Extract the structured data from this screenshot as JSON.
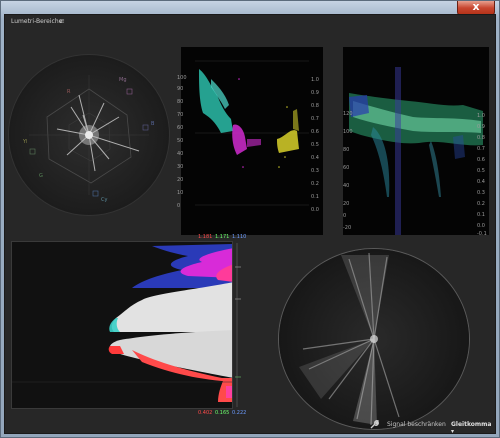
{
  "window": {
    "close_glyph": "x"
  },
  "panel": {
    "title": "Lumetri-Bereiche",
    "menu_glyph": "≡"
  },
  "waveform1": {
    "left_ticks": [
      "100",
      "90",
      "80",
      "70",
      "60",
      "50",
      "40",
      "30",
      "20",
      "10",
      "0"
    ],
    "right_ticks": [
      "1.0",
      "0.9",
      "0.8",
      "0.7",
      "0.6",
      "0.5",
      "0.4",
      "0.3",
      "0.2",
      "0.1",
      "0.0"
    ]
  },
  "waveform2": {
    "left_ticks": [
      "120",
      "100",
      "80",
      "60",
      "40",
      "20",
      "0",
      "-20"
    ],
    "right_ticks": [
      "1.0",
      "0.9",
      "0.8",
      "0.7",
      "0.6",
      "0.5",
      "0.4",
      "0.3",
      "0.2",
      "0.1",
      "0.0",
      "-0.1"
    ]
  },
  "histogram": {
    "top_values": [
      {
        "text": "1.181",
        "color": "#ff4a4a"
      },
      {
        "text": "1.171",
        "color": "#6cff6c"
      },
      {
        "text": "1.110",
        "color": "#6c9cff"
      }
    ],
    "bottom_values": [
      {
        "text": "0.402",
        "color": "#ff4a4a"
      },
      {
        "text": "0.165",
        "color": "#6cff6c"
      },
      {
        "text": "0.222",
        "color": "#6c9cff"
      }
    ]
  },
  "vectorscope": {
    "targets": [
      "R",
      "Mg",
      "B",
      "Cy",
      "G",
      "Yl"
    ]
  },
  "footer": {
    "wrench_icon": "wrench-icon",
    "signal_label": "Signal beschränken",
    "mode_label": "Gleitkomma",
    "mode_caret": "▾"
  }
}
